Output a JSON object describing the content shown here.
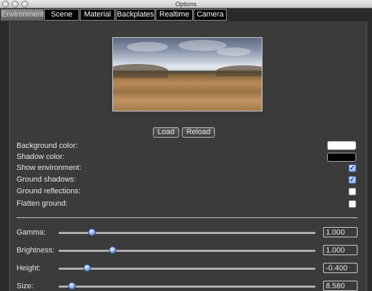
{
  "window": {
    "title": "Options"
  },
  "tabs": [
    {
      "label": "Environment",
      "active": true
    },
    {
      "label": "Scene",
      "active": false
    },
    {
      "label": "Material",
      "active": false
    },
    {
      "label": "Backplates",
      "active": false
    },
    {
      "label": "Realtime",
      "active": false
    },
    {
      "label": "Camera",
      "active": false
    }
  ],
  "buttons": {
    "load": "Load",
    "reload": "Reload"
  },
  "colors": {
    "background_color": "#ffffff",
    "shadow_color": "#000000"
  },
  "settings": {
    "background_color": "Background color:",
    "shadow_color": "Shadow color:",
    "show_environment": {
      "label": "Show environment:",
      "checked": true
    },
    "ground_shadows": {
      "label": "Ground shadows:",
      "checked": true
    },
    "ground_reflections": {
      "label": "Ground reflections:",
      "checked": false
    },
    "flatten_ground": {
      "label": "Flatten ground:",
      "checked": false
    }
  },
  "sliders": [
    {
      "label": "Gamma:",
      "value": "1.000",
      "position_fraction": 0.13
    },
    {
      "label": "Brightness:",
      "value": "1.000",
      "position_fraction": 0.21
    },
    {
      "label": "Height:",
      "value": "-0.400",
      "position_fraction": 0.11
    },
    {
      "label": "Size:",
      "value": "8.580",
      "position_fraction": 0.05
    }
  ]
}
